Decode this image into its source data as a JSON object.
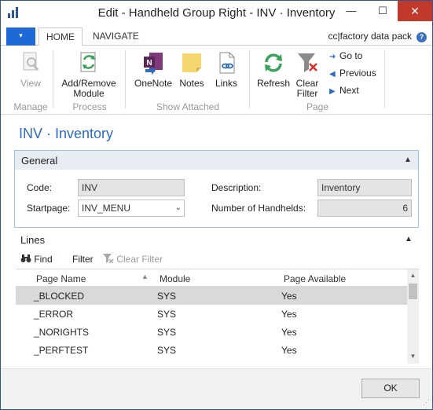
{
  "window": {
    "title": "Edit - Handheld Group Right - INV · Inventory",
    "minimize": "—",
    "maximize": "☐",
    "close": "✕"
  },
  "ribbon_tabs": {
    "file_icon": "▾",
    "home": "HOME",
    "navigate": "NAVIGATE",
    "company": "cc|factory data pack",
    "help": "?"
  },
  "ribbon": {
    "manage": {
      "label": "Manage",
      "view": "View"
    },
    "process": {
      "label": "Process",
      "add_remove_line1": "Add/Remove",
      "add_remove_line2": "Module"
    },
    "show_attached": {
      "label": "Show Attached",
      "onenote": "OneNote",
      "notes": "Notes",
      "links": "Links"
    },
    "page": {
      "label": "Page",
      "refresh": "Refresh",
      "clear_filter_line1": "Clear",
      "clear_filter_line2": "Filter",
      "go_to": "Go to",
      "previous": "Previous",
      "next": "Next"
    }
  },
  "page_title": "INV · Inventory",
  "general": {
    "title": "General",
    "code_label": "Code:",
    "code_value": "INV",
    "startpage_label": "Startpage:",
    "startpage_value": "INV_MENU",
    "description_label": "Description:",
    "description_value": "Inventory",
    "handhelds_label": "Number of Handhelds:",
    "handhelds_value": "6"
  },
  "lines": {
    "title": "Lines",
    "find": "Find",
    "filter": "Filter",
    "clear_filter": "Clear Filter",
    "columns": [
      "Page Name",
      "Module",
      "Page Available"
    ],
    "rows": [
      {
        "page_name": "_BLOCKED",
        "module": "SYS",
        "available": "Yes"
      },
      {
        "page_name": "_ERROR",
        "module": "SYS",
        "available": "Yes"
      },
      {
        "page_name": "_NORIGHTS",
        "module": "SYS",
        "available": "Yes"
      },
      {
        "page_name": "_PERFTEST",
        "module": "SYS",
        "available": "Yes"
      }
    ]
  },
  "footer": {
    "ok": "OK"
  },
  "colors": {
    "accent": "#2b6cc4",
    "file_button": "#1d6ad6",
    "close_button": "#c0392b",
    "onenote": "#80397b",
    "refresh": "#3aa35a"
  }
}
